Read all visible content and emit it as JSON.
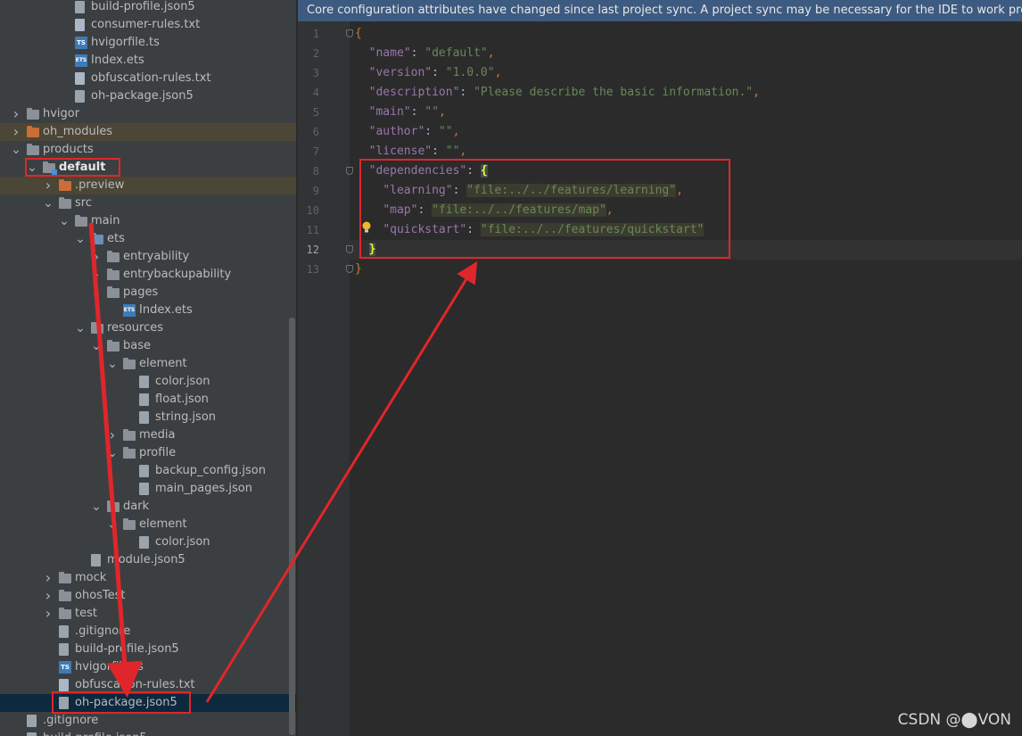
{
  "notification": {
    "text": "Core configuration attributes have changed since last project sync. A project sync may be necessary for the IDE to work properly."
  },
  "tree": [
    {
      "label": "build-profile.json5",
      "icon": "json-file",
      "level": 4,
      "chevron": "none"
    },
    {
      "label": "consumer-rules.txt",
      "icon": "text-file",
      "level": 4,
      "chevron": "none"
    },
    {
      "label": "hvigorfile.ts",
      "icon": "ts-file",
      "level": 4,
      "chevron": "none"
    },
    {
      "label": "Index.ets",
      "icon": "ets-file",
      "level": 4,
      "chevron": "none"
    },
    {
      "label": "obfuscation-rules.txt",
      "icon": "text-file",
      "level": 4,
      "chevron": "none"
    },
    {
      "label": "oh-package.json5",
      "icon": "json-file",
      "level": 4,
      "chevron": "none"
    },
    {
      "label": "hvigor",
      "icon": "folder",
      "level": 1,
      "chevron": "collapsed"
    },
    {
      "label": "oh_modules",
      "icon": "folder-orange",
      "level": 1,
      "chevron": "collapsed",
      "highlight": true
    },
    {
      "label": "products",
      "icon": "folder",
      "level": 1,
      "chevron": "expanded"
    },
    {
      "label": "default",
      "icon": "module-folder",
      "level": 2,
      "chevron": "expanded",
      "bold": true
    },
    {
      "label": ".preview",
      "icon": "folder-orange",
      "level": 3,
      "chevron": "collapsed",
      "highlight": true
    },
    {
      "label": "src",
      "icon": "folder",
      "level": 3,
      "chevron": "expanded"
    },
    {
      "label": "main",
      "icon": "folder",
      "level": 4,
      "chevron": "expanded"
    },
    {
      "label": "ets",
      "icon": "folder-blue",
      "level": 5,
      "chevron": "expanded"
    },
    {
      "label": "entryability",
      "icon": "folder",
      "level": 6,
      "chevron": "collapsed"
    },
    {
      "label": "entrybackupability",
      "icon": "folder",
      "level": 6,
      "chevron": "collapsed"
    },
    {
      "label": "pages",
      "icon": "folder",
      "level": 6,
      "chevron": "expanded"
    },
    {
      "label": "Index.ets",
      "icon": "ets-file",
      "level": 7,
      "chevron": "none"
    },
    {
      "label": "resources",
      "icon": "folder",
      "level": 5,
      "chevron": "expanded"
    },
    {
      "label": "base",
      "icon": "folder",
      "level": 6,
      "chevron": "expanded"
    },
    {
      "label": "element",
      "icon": "folder",
      "level": 7,
      "chevron": "expanded"
    },
    {
      "label": "color.json",
      "icon": "json-file",
      "level": 8,
      "chevron": "none"
    },
    {
      "label": "float.json",
      "icon": "json-file",
      "level": 8,
      "chevron": "none"
    },
    {
      "label": "string.json",
      "icon": "json-file",
      "level": 8,
      "chevron": "none"
    },
    {
      "label": "media",
      "icon": "folder",
      "level": 7,
      "chevron": "collapsed"
    },
    {
      "label": "profile",
      "icon": "folder",
      "level": 7,
      "chevron": "expanded"
    },
    {
      "label": "backup_config.json",
      "icon": "json-file",
      "level": 8,
      "chevron": "none"
    },
    {
      "label": "main_pages.json",
      "icon": "json-file",
      "level": 8,
      "chevron": "none"
    },
    {
      "label": "dark",
      "icon": "folder",
      "level": 6,
      "chevron": "expanded"
    },
    {
      "label": "element",
      "icon": "folder",
      "level": 7,
      "chevron": "expanded"
    },
    {
      "label": "color.json",
      "icon": "json-file",
      "level": 8,
      "chevron": "none"
    },
    {
      "label": "module.json5",
      "icon": "json-file",
      "level": 5,
      "chevron": "none"
    },
    {
      "label": "mock",
      "icon": "folder",
      "level": 3,
      "chevron": "collapsed"
    },
    {
      "label": "ohosTest",
      "icon": "folder",
      "level": 3,
      "chevron": "collapsed"
    },
    {
      "label": "test",
      "icon": "folder",
      "level": 3,
      "chevron": "collapsed"
    },
    {
      "label": ".gitignore",
      "icon": "json-file",
      "level": 3,
      "chevron": "none"
    },
    {
      "label": "build-profile.json5",
      "icon": "json-file",
      "level": 3,
      "chevron": "none"
    },
    {
      "label": "hvigorfile.ts",
      "icon": "ts-file",
      "level": 3,
      "chevron": "none"
    },
    {
      "label": "obfuscation-rules.txt",
      "icon": "text-file",
      "level": 3,
      "chevron": "none"
    },
    {
      "label": "oh-package.json5",
      "icon": "json-file",
      "level": 3,
      "chevron": "none",
      "active": true
    },
    {
      "label": ".gitignore",
      "icon": "json-file",
      "level": 1,
      "chevron": "none"
    },
    {
      "label": "build-profile.json5",
      "icon": "json-file",
      "level": 1,
      "chevron": "none"
    }
  ],
  "editor": {
    "current_line": 12,
    "lines": [
      {
        "n": "1",
        "tokens": [
          {
            "t": "p",
            "v": "{"
          }
        ]
      },
      {
        "n": "2",
        "tokens": [
          {
            "t": "",
            "v": "  "
          },
          {
            "t": "k",
            "v": "\"name\""
          },
          {
            "t": "",
            "v": ": "
          },
          {
            "t": "s",
            "v": "\"default\""
          },
          {
            "t": "p",
            "v": ","
          }
        ]
      },
      {
        "n": "3",
        "tokens": [
          {
            "t": "",
            "v": "  "
          },
          {
            "t": "k",
            "v": "\"version\""
          },
          {
            "t": "",
            "v": ": "
          },
          {
            "t": "s",
            "v": "\"1.0.0\""
          },
          {
            "t": "p",
            "v": ","
          }
        ]
      },
      {
        "n": "4",
        "tokens": [
          {
            "t": "",
            "v": "  "
          },
          {
            "t": "k",
            "v": "\"description\""
          },
          {
            "t": "",
            "v": ": "
          },
          {
            "t": "s",
            "v": "\"Please describe the basic information.\""
          },
          {
            "t": "p",
            "v": ","
          }
        ]
      },
      {
        "n": "5",
        "tokens": [
          {
            "t": "",
            "v": "  "
          },
          {
            "t": "k",
            "v": "\"main\""
          },
          {
            "t": "",
            "v": ": "
          },
          {
            "t": "s",
            "v": "\"\""
          },
          {
            "t": "p",
            "v": ","
          }
        ]
      },
      {
        "n": "6",
        "tokens": [
          {
            "t": "",
            "v": "  "
          },
          {
            "t": "k",
            "v": "\"author\""
          },
          {
            "t": "",
            "v": ": "
          },
          {
            "t": "s",
            "v": "\"\""
          },
          {
            "t": "p",
            "v": ","
          }
        ]
      },
      {
        "n": "7",
        "tokens": [
          {
            "t": "",
            "v": "  "
          },
          {
            "t": "k",
            "v": "\"license\""
          },
          {
            "t": "",
            "v": ": "
          },
          {
            "t": "s",
            "v": "\"\""
          },
          {
            "t": "p",
            "v": ","
          }
        ]
      },
      {
        "n": "8",
        "tokens": [
          {
            "t": "",
            "v": "  "
          },
          {
            "t": "k",
            "v": "\"dependencies\""
          },
          {
            "t": "",
            "v": ": "
          },
          {
            "t": "bm",
            "v": "{"
          }
        ]
      },
      {
        "n": "9",
        "tokens": [
          {
            "t": "",
            "v": "    "
          },
          {
            "t": "k",
            "v": "\"learning\""
          },
          {
            "t": "",
            "v": ": "
          },
          {
            "t": "s hl",
            "v": "\"file:../../features/learning\""
          },
          {
            "t": "p",
            "v": ","
          }
        ]
      },
      {
        "n": "10",
        "tokens": [
          {
            "t": "",
            "v": "    "
          },
          {
            "t": "k",
            "v": "\"map\""
          },
          {
            "t": "",
            "v": ": "
          },
          {
            "t": "s hl",
            "v": "\"file:../../features/map\""
          },
          {
            "t": "p",
            "v": ","
          }
        ]
      },
      {
        "n": "11",
        "tokens": [
          {
            "t": "",
            "v": "    "
          },
          {
            "t": "k",
            "v": "\"quickstart\""
          },
          {
            "t": "",
            "v": ": "
          },
          {
            "t": "s hl",
            "v": "\"file:../../features/quickstart\""
          }
        ]
      },
      {
        "n": "12",
        "tokens": [
          {
            "t": "",
            "v": "  "
          },
          {
            "t": "bm",
            "v": "}"
          }
        ]
      },
      {
        "n": "13",
        "tokens": [
          {
            "t": "p",
            "v": "}"
          }
        ]
      }
    ]
  },
  "watermark": "CSDN @⬤VON",
  "colors": {
    "annotation_red": "#e0262b",
    "selected_row": "#0d293e",
    "excluded_row": "#4b4636"
  }
}
